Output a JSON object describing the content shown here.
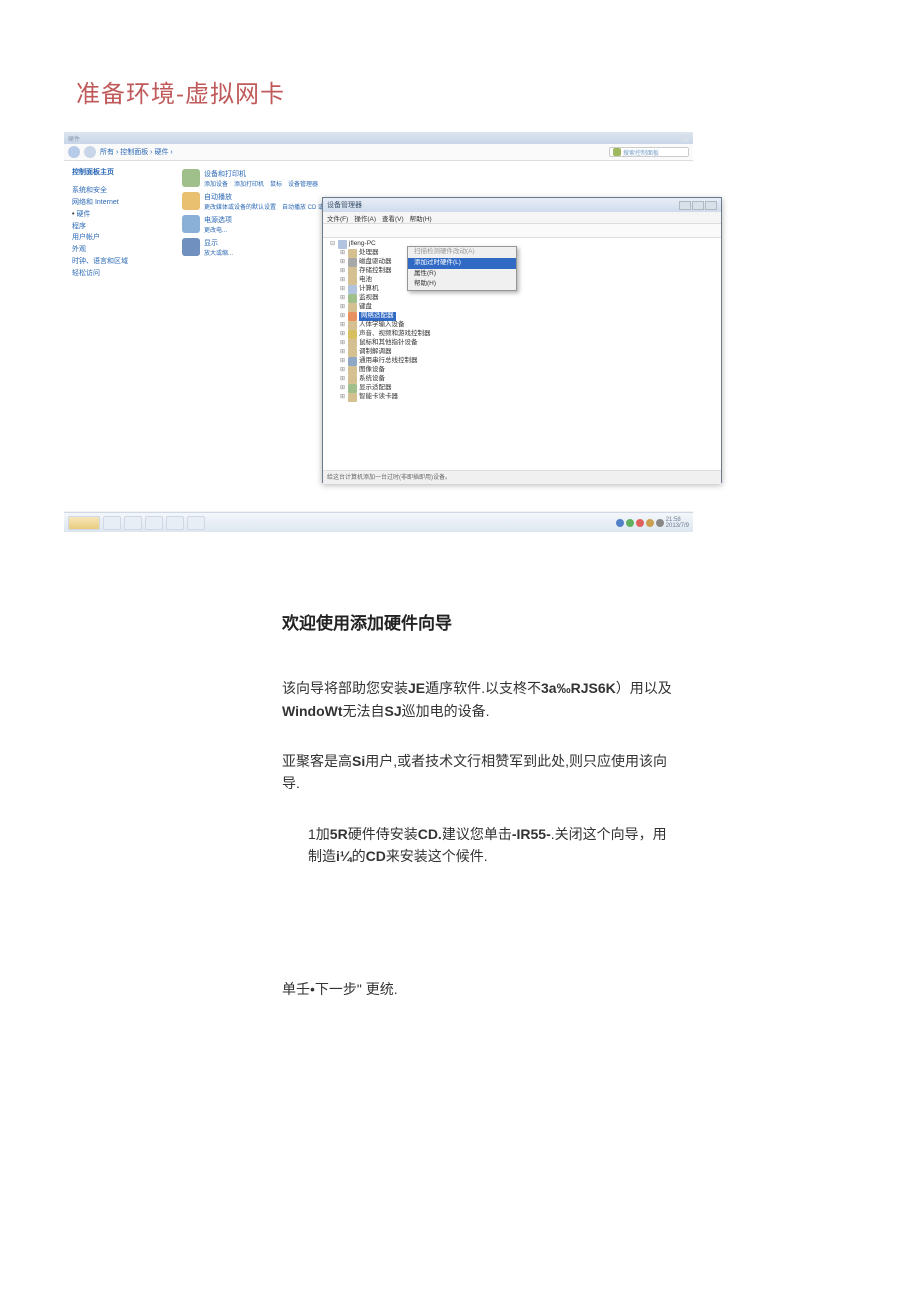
{
  "doc": {
    "title": "准备环境-虚拟网卡"
  },
  "control_panel": {
    "window_title": "硬件",
    "breadcrumb": "所有 › 控制面板 › 硬件 ›",
    "search_placeholder": "搜索控制面板",
    "sidebar": {
      "home": "控制面板主页",
      "items": [
        "系统和安全",
        "网络和 Internet",
        "硬件",
        "程序",
        "用户帐户",
        "外观",
        "时钟、语言和区域",
        "轻松访问"
      ]
    },
    "categories": [
      {
        "head": "设备和打印机",
        "sub": "添加设备　添加打印机　鼠标　设备管理器"
      },
      {
        "head": "自动播放",
        "sub": "更改媒体或设备的默认设置　自动播放 CD 或其他媒体"
      },
      {
        "head": "电源选项",
        "sub": "更改电..."
      },
      {
        "head": "显示",
        "sub": "放大或缩..."
      }
    ]
  },
  "device_manager": {
    "title": "设备管理器",
    "menu": [
      "文件(F)",
      "操作(A)",
      "查看(V)",
      "帮助(H)"
    ],
    "root": "jfleng-PC",
    "context_menu": {
      "scan": "扫描检测硬件改动(A)",
      "add": "添加过时硬件(L)",
      "props": "属性(R)",
      "help": "帮助(H)"
    },
    "nodes": [
      "处理器",
      "磁盘驱动器",
      "存储控制器",
      "电池",
      "计算机",
      "监视器",
      "键盘",
      "网络适配器",
      "人体学输入设备",
      "声音、视频和游戏控制器",
      "鼠标和其他指针设备",
      "调制解调器",
      "通用串行总线控制器",
      "图像设备",
      "系统设备",
      "显示适配器",
      "智能卡读卡器"
    ],
    "status": "给这台计算机添加一台过时(非即插即用)设备。"
  },
  "taskbar": {
    "time": "21:58",
    "date": "2013/7/9"
  },
  "wizard": {
    "heading": "欢迎使用添加硬件向导",
    "p1a": "该向导将部助您安装",
    "p1b": "JE",
    "p1c": "遁序软件.以支柊不",
    "p1d": "3a‰RJS6K",
    "p1e": "）用以及",
    "p1f": "WindoWt",
    "p1g": "无法自",
    "p1h": "SJ",
    "p1i": "巡加电的设备.",
    "p2a": "亚聚客是高",
    "p2b": "Si",
    "p2c": "用户,或者技术文行相赞军到此处,则只应使用该向导.",
    "p3a": "1",
    "p3b": "加",
    "p3c": "5R",
    "p3d": "硬件侍安装",
    "p3e": "CD.",
    "p3f": "建议您单击",
    "p3g": "-IR55-",
    "p3h": ".关闭这个向导，用制造",
    "p3i": "i¼",
    "p3j": "的",
    "p3k": "CD",
    "p3l": "来安装这个候件.",
    "foot": "单壬•下一步\" 更统."
  }
}
